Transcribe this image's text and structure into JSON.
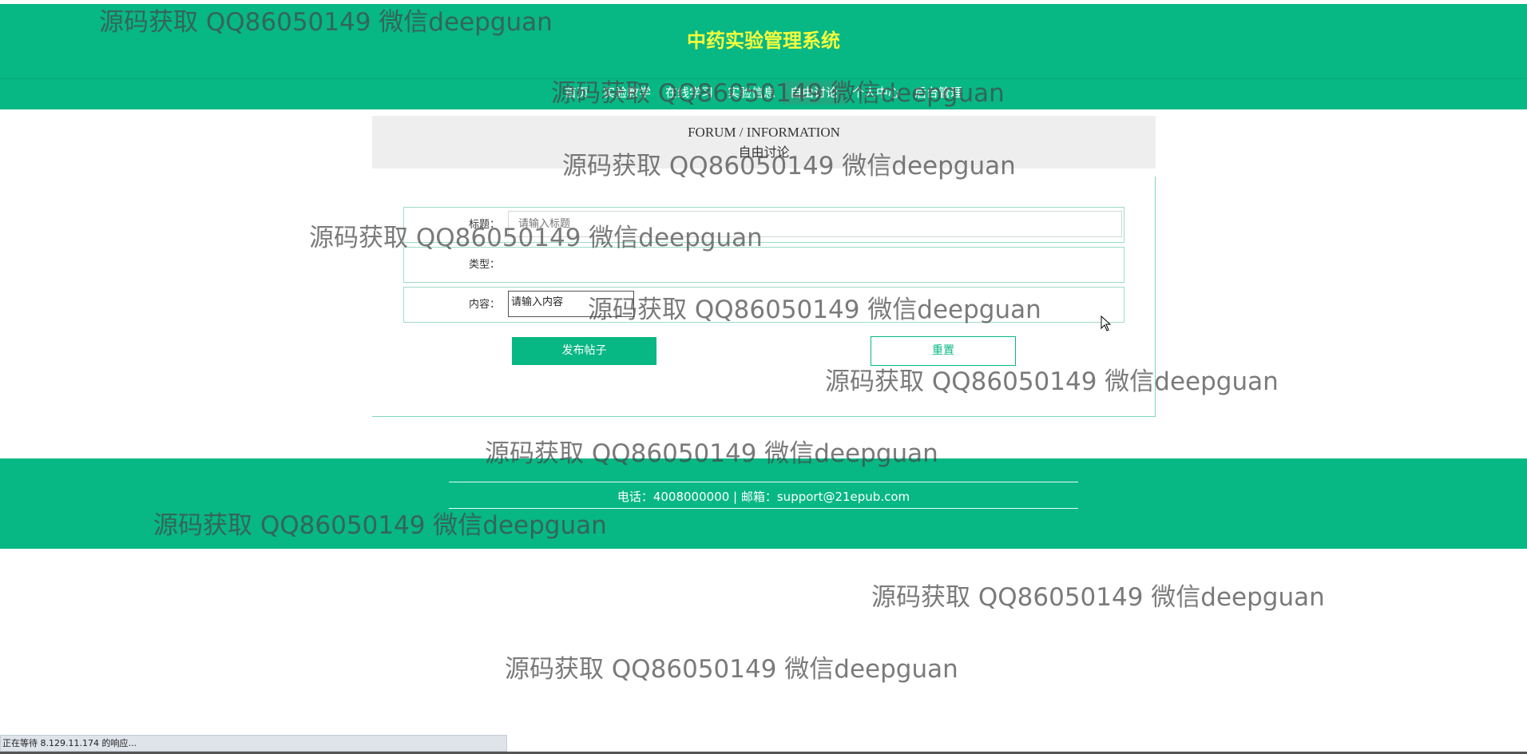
{
  "header": {
    "site_title": "中药实验管理系统",
    "nav": [
      "首页",
      "实验教学",
      "在线学习",
      "实验信息",
      "自由讨论",
      "个人中心",
      "后台管理"
    ],
    "active_index": 4
  },
  "banner": {
    "title_en": "FORUM / INFORMATION",
    "title_cn": "自由讨论"
  },
  "form": {
    "title_label": "标题：",
    "title_placeholder": "请输入标题",
    "type_label": "类型：",
    "content_label": "内容：",
    "content_value": "请输入内容",
    "submit_label": "发布帖子",
    "reset_label": "重置"
  },
  "footer": {
    "contact": "电话：4008000000 | 邮箱：support@21epub.com"
  },
  "watermark_text": "源码获取 QQ86050149 微信deepguan",
  "statusbar": {
    "text": "正在等待 8.129.11.174 的响应..."
  },
  "colors": {
    "primary": "#07b784",
    "title": "#f6ff3c",
    "banner_bg": "#eeeeee"
  }
}
